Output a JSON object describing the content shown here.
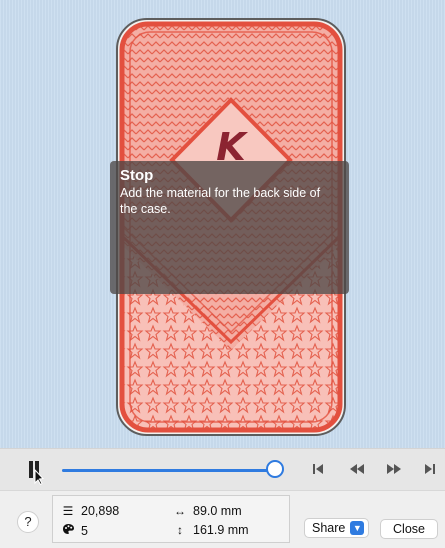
{
  "stop_dialog": {
    "title": "Stop",
    "message": "Add the material for the back side of the case."
  },
  "design": {
    "monogram_letter": "K",
    "colors": {
      "canvas_background": "#c9dcef",
      "case_fill": "#f3a59b",
      "case_outline": "#e3503f",
      "case_border": "#5d5d5d",
      "monogram": "#8c2431"
    }
  },
  "playback": {
    "progress": 1.0,
    "accent_color": "#2f7be0",
    "icons": [
      "stop-marker-icon",
      "skip-to-start-icon",
      "rewind-icon",
      "fast-forward-icon",
      "skip-to-end-icon"
    ]
  },
  "stats": {
    "stitch_count": "20,898",
    "color_count": "5",
    "width": "89.0 mm",
    "height": "161.9 mm",
    "icons": [
      "stitches-icon",
      "palette-icon",
      "width-arrow-icon",
      "height-arrow-icon"
    ]
  },
  "footer": {
    "help_label": "?",
    "share_label": "Share",
    "share_chevron_icon": "chevron-down-icon",
    "close_label": "Close"
  }
}
